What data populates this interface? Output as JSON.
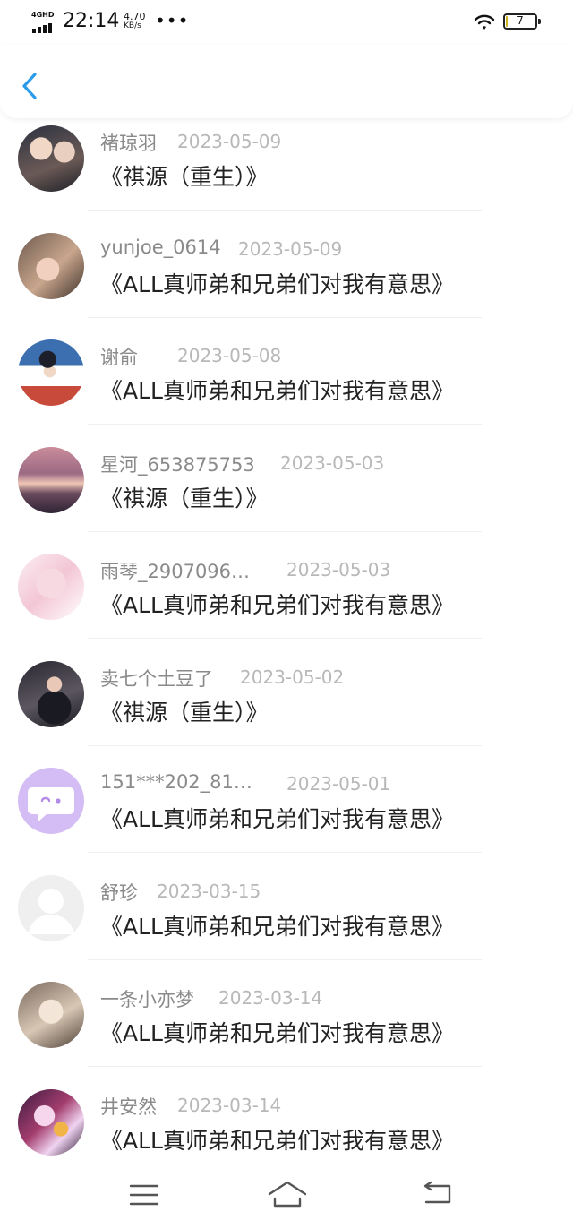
{
  "status_bar": {
    "network": "4GHD",
    "time": "22:14",
    "speed_value": "4.70",
    "speed_unit": "KB/s",
    "more": "•••",
    "battery_level": "7",
    "battery_fraction": 0.07,
    "battery_color": "#c9b21a"
  },
  "header": {
    "back_icon": "chevron-left-icon",
    "accent_color": "#2a9bea"
  },
  "comments": [
    {
      "user": "褚琼羽",
      "date": "2023-05-09",
      "book": "《祺源（重生）》",
      "avatar": "photo-avatar"
    },
    {
      "user": "yunjoe_0614",
      "date": "2023-05-09",
      "book": "《ALL真师弟和兄弟们对我有意思》",
      "avatar": "photo-avatar"
    },
    {
      "user": "谢俞",
      "date": "2023-05-08",
      "book": "《ALL真师弟和兄弟们对我有意思》",
      "avatar": "photo-avatar"
    },
    {
      "user": "星河_653875753",
      "date": "2023-05-03",
      "book": "《祺源（重生）》",
      "avatar": "sunset-avatar"
    },
    {
      "user": "雨琴_2907096…",
      "date": "2023-05-03",
      "book": "《ALL真师弟和兄弟们对我有意思》",
      "avatar": "drawing-avatar"
    },
    {
      "user": "卖七个土豆了",
      "date": "2023-05-02",
      "book": "《祺源（重生）》",
      "avatar": "photo-avatar"
    },
    {
      "user": "151***202_81…",
      "date": "2023-05-01",
      "book": "《ALL真师弟和兄弟们对我有意思》",
      "avatar": "chat-bubble-avatar"
    },
    {
      "user": "舒珍",
      "date": "2023-03-15",
      "book": "《ALL真师弟和兄弟们对我有意思》",
      "avatar": "default-user-avatar"
    },
    {
      "user": "一条小亦梦",
      "date": "2023-03-14",
      "book": "《ALL真师弟和兄弟们对我有意思》",
      "avatar": "photo-avatar"
    },
    {
      "user": "井安然",
      "date": "2023-03-14",
      "book": "《ALL真师弟和兄弟们对我有意思》",
      "avatar": "photo-avatar"
    }
  ],
  "navbar": {
    "icons": [
      "menu-icon",
      "home-icon",
      "back-icon"
    ]
  }
}
